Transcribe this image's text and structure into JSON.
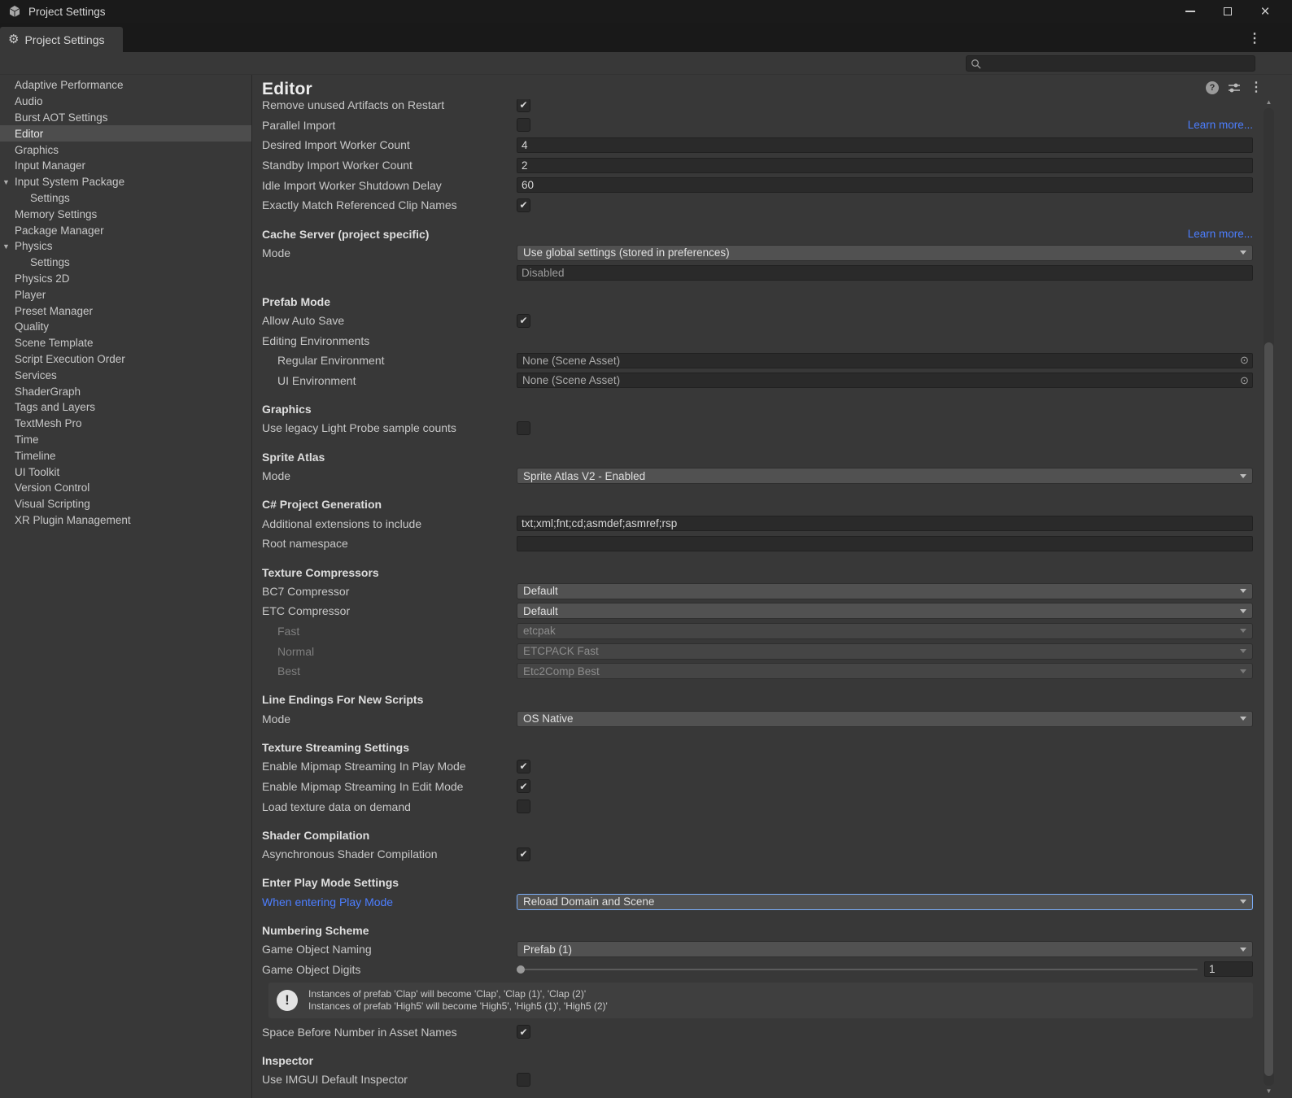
{
  "window": {
    "title": "Project Settings"
  },
  "tabbar": {
    "tab_label": "Project Settings"
  },
  "search": {
    "value": ""
  },
  "colors": {
    "link": "#4C7EFF",
    "focus_border": "#7BAEFA",
    "sidebar_selected": "#4D4D4D"
  },
  "sidebar": {
    "items": [
      {
        "label": "Adaptive Performance"
      },
      {
        "label": "Audio"
      },
      {
        "label": "Burst AOT Settings"
      },
      {
        "label": "Editor",
        "selected": true
      },
      {
        "label": "Graphics"
      },
      {
        "label": "Input Manager"
      },
      {
        "label": "Input System Package",
        "foldout": true
      },
      {
        "label": "Settings",
        "indent": 1
      },
      {
        "label": "Memory Settings"
      },
      {
        "label": "Package Manager"
      },
      {
        "label": "Physics",
        "foldout": true
      },
      {
        "label": "Settings",
        "indent": 1
      },
      {
        "label": "Physics 2D"
      },
      {
        "label": "Player"
      },
      {
        "label": "Preset Manager"
      },
      {
        "label": "Quality"
      },
      {
        "label": "Scene Template"
      },
      {
        "label": "Script Execution Order"
      },
      {
        "label": "Services"
      },
      {
        "label": "ShaderGraph"
      },
      {
        "label": "Tags and Layers"
      },
      {
        "label": "TextMesh Pro"
      },
      {
        "label": "Time"
      },
      {
        "label": "Timeline"
      },
      {
        "label": "UI Toolkit"
      },
      {
        "label": "Version Control"
      },
      {
        "label": "Visual Scripting"
      },
      {
        "label": "XR Plugin Management"
      }
    ]
  },
  "editor": {
    "title": "Editor",
    "blocks": [
      {
        "type": "row",
        "label": "Remove unused Artifacts on Restart",
        "control": {
          "kind": "checkbox",
          "checked": true
        }
      },
      {
        "type": "row",
        "label": "Parallel Import",
        "control": {
          "kind": "checkbox",
          "checked": false
        },
        "link": "Learn more..."
      },
      {
        "type": "row",
        "label": "Desired Import Worker Count",
        "control": {
          "kind": "text",
          "value": "4"
        }
      },
      {
        "type": "row",
        "label": "Standby Import Worker Count",
        "control": {
          "kind": "text",
          "value": "2"
        }
      },
      {
        "type": "row",
        "label": "Idle Import Worker Shutdown Delay",
        "control": {
          "kind": "text",
          "value": "60"
        }
      },
      {
        "type": "row",
        "label": "Exactly Match Referenced Clip Names",
        "control": {
          "kind": "checkbox",
          "checked": true
        }
      },
      {
        "type": "section",
        "title": "Cache Server (project specific)",
        "link": "Learn more..."
      },
      {
        "type": "row",
        "label": "Mode",
        "control": {
          "kind": "dropdown",
          "value": "Use global settings (stored in preferences)"
        }
      },
      {
        "type": "row",
        "label": "",
        "control": {
          "kind": "readonly",
          "value": "Disabled"
        }
      },
      {
        "type": "section",
        "title": "Prefab Mode"
      },
      {
        "type": "row",
        "label": "Allow Auto Save",
        "control": {
          "kind": "checkbox",
          "checked": true
        }
      },
      {
        "type": "row",
        "label": "Editing Environments",
        "control": {
          "kind": "none"
        }
      },
      {
        "type": "row",
        "label": "Regular Environment",
        "indent": 1,
        "control": {
          "kind": "object",
          "value": "None (Scene Asset)"
        }
      },
      {
        "type": "row",
        "label": "UI Environment",
        "indent": 1,
        "control": {
          "kind": "object",
          "value": "None (Scene Asset)"
        }
      },
      {
        "type": "section",
        "title": "Graphics"
      },
      {
        "type": "row",
        "label": "Use legacy Light Probe sample counts",
        "control": {
          "kind": "checkbox",
          "checked": false
        }
      },
      {
        "type": "section",
        "title": "Sprite Atlas"
      },
      {
        "type": "row",
        "label": "Mode",
        "control": {
          "kind": "dropdown",
          "value": "Sprite Atlas V2 - Enabled"
        }
      },
      {
        "type": "section",
        "title": "C# Project Generation"
      },
      {
        "type": "row",
        "label": "Additional extensions to include",
        "control": {
          "kind": "text",
          "value": "txt;xml;fnt;cd;asmdef;asmref;rsp"
        }
      },
      {
        "type": "row",
        "label": "Root namespace",
        "control": {
          "kind": "text",
          "value": ""
        }
      },
      {
        "type": "section",
        "title": "Texture Compressors"
      },
      {
        "type": "row",
        "label": "BC7 Compressor",
        "control": {
          "kind": "dropdown",
          "value": "Default"
        }
      },
      {
        "type": "row",
        "label": "ETC Compressor",
        "control": {
          "kind": "dropdown",
          "value": "Default"
        }
      },
      {
        "type": "row",
        "label": "Fast",
        "indent": 1,
        "disabled": true,
        "control": {
          "kind": "dropdown",
          "value": "etcpak",
          "disabled": true
        }
      },
      {
        "type": "row",
        "label": "Normal",
        "indent": 1,
        "disabled": true,
        "control": {
          "kind": "dropdown",
          "value": "ETCPACK Fast",
          "disabled": true
        }
      },
      {
        "type": "row",
        "label": "Best",
        "indent": 1,
        "disabled": true,
        "control": {
          "kind": "dropdown",
          "value": "Etc2Comp Best",
          "disabled": true
        }
      },
      {
        "type": "section",
        "title": "Line Endings For New Scripts"
      },
      {
        "type": "row",
        "label": "Mode",
        "control": {
          "kind": "dropdown",
          "value": "OS Native"
        }
      },
      {
        "type": "section",
        "title": "Texture Streaming Settings"
      },
      {
        "type": "row",
        "label": "Enable Mipmap Streaming In Play Mode",
        "control": {
          "kind": "checkbox",
          "checked": true
        }
      },
      {
        "type": "row",
        "label": "Enable Mipmap Streaming In Edit Mode",
        "control": {
          "kind": "checkbox",
          "checked": true
        }
      },
      {
        "type": "row",
        "label": "Load texture data on demand",
        "control": {
          "kind": "checkbox",
          "checked": false
        }
      },
      {
        "type": "section",
        "title": "Shader Compilation"
      },
      {
        "type": "row",
        "label": "Asynchronous Shader Compilation",
        "control": {
          "kind": "checkbox",
          "checked": true
        }
      },
      {
        "type": "section",
        "title": "Enter Play Mode Settings"
      },
      {
        "type": "row",
        "label": "When entering Play Mode",
        "label_color": "blue",
        "control": {
          "kind": "dropdown",
          "value": "Reload Domain and Scene",
          "focused": true
        }
      },
      {
        "type": "section",
        "title": "Numbering Scheme"
      },
      {
        "type": "row",
        "label": "Game Object Naming",
        "control": {
          "kind": "dropdown",
          "value": "Prefab (1)"
        }
      },
      {
        "type": "row",
        "label": "Game Object Digits",
        "control": {
          "kind": "slider",
          "value": "1"
        }
      },
      {
        "type": "infobox",
        "lines": [
          "Instances of prefab 'Clap' will become 'Clap', 'Clap (1)', 'Clap (2)'",
          "Instances of prefab 'High5' will become 'High5', 'High5 (1)', 'High5 (2)'"
        ]
      },
      {
        "type": "row",
        "label": "Space Before Number in Asset Names",
        "control": {
          "kind": "checkbox",
          "checked": true
        }
      },
      {
        "type": "section",
        "title": "Inspector"
      },
      {
        "type": "row",
        "label": "Use IMGUI Default Inspector",
        "control": {
          "kind": "checkbox",
          "checked": false
        }
      }
    ]
  }
}
